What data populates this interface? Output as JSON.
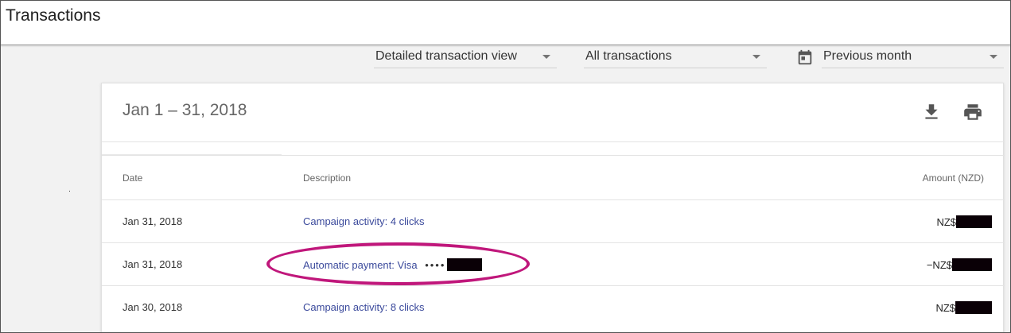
{
  "header": {
    "title": "Transactions"
  },
  "filters": {
    "view": "Detailed transaction view",
    "type": "All transactions",
    "period": "Previous month"
  },
  "card": {
    "title": "Jan 1 – 31, 2018",
    "columns": {
      "date": "Date",
      "description": "Description",
      "amount": "Amount (NZD)"
    },
    "rows": [
      {
        "date": "Jan 31, 2018",
        "description": "Campaign activity: 4 clicks",
        "amount_prefix": "NZ$",
        "amount_value": "[redacted]"
      },
      {
        "date": "Jan 31, 2018",
        "description": "Automatic payment: Visa",
        "card_mask": "••••",
        "card_number": "[redacted]",
        "amount_prefix": "−NZ$",
        "amount_value": "[redacted]"
      },
      {
        "date": "Jan 30, 2018",
        "description": "Campaign activity: 8 clicks",
        "amount_prefix": "NZ$",
        "amount_value": "[redacted]"
      }
    ]
  },
  "icons": {
    "period": "calendar-icon",
    "download": "download-icon",
    "print": "print-icon"
  },
  "colors": {
    "link": "#3b4a9c",
    "highlight": "#c0177b",
    "redaction": "#0a0006"
  }
}
